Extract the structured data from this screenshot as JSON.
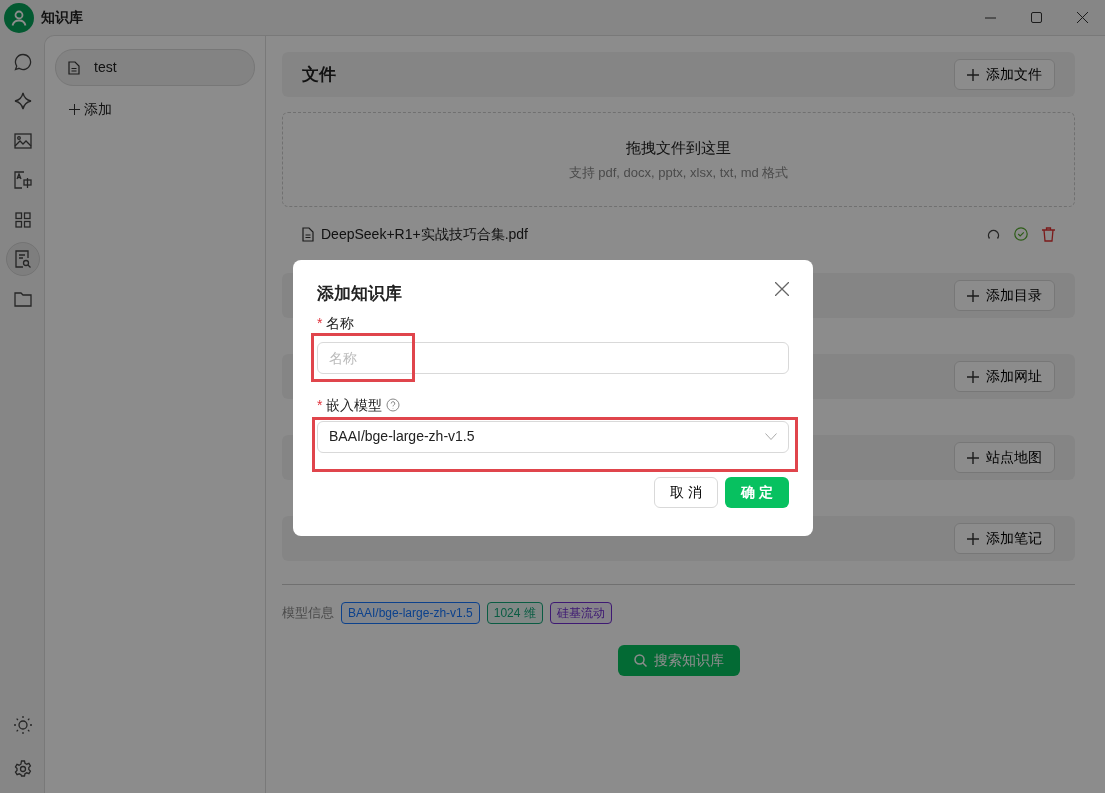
{
  "window": {
    "title": "知识库"
  },
  "rail": [
    {
      "kind": "chat",
      "selected": false
    },
    {
      "kind": "sparkle",
      "selected": false
    },
    {
      "kind": "image",
      "selected": false
    },
    {
      "kind": "translate",
      "selected": false
    },
    {
      "kind": "grid",
      "selected": false
    },
    {
      "kind": "knowledge",
      "selected": true
    },
    {
      "kind": "folder",
      "selected": false
    }
  ],
  "rail_bottom": [
    {
      "kind": "sun"
    },
    {
      "kind": "gear"
    }
  ],
  "knowledge_bases": [
    {
      "name": "test",
      "selected": true
    }
  ],
  "add_knowledge_base": "添加",
  "sections": [
    {
      "kind": "files",
      "title": "文件",
      "button": "添加文件"
    },
    {
      "kind": "plain",
      "button": "添加目录"
    },
    {
      "kind": "plain",
      "button": "添加网址"
    },
    {
      "kind": "plain",
      "button": "站点地图"
    },
    {
      "kind": "plain",
      "button": "添加笔记"
    }
  ],
  "dropzone": {
    "title": "拖拽文件到这里",
    "hint": "支持 pdf, docx, pptx, xlsx, txt, md 格式"
  },
  "files": [
    {
      "name": "DeepSeek+R1+实战技巧合集.pdf",
      "done": true
    }
  ],
  "model_info": {
    "label": "模型信息",
    "tags": [
      {
        "text": "BAAI/bge-large-zh-v1.5",
        "kind": "model"
      },
      {
        "text": "1024 维",
        "kind": "dimension"
      },
      {
        "text": "硅基流动",
        "kind": "provider"
      }
    ]
  },
  "search_button": "搜索知识库",
  "dialog": {
    "title": "添加知识库",
    "name_field": {
      "mark": "*",
      "label": "名称",
      "placeholder": "名称",
      "highlighted": true
    },
    "model_field": {
      "mark": "*",
      "label": "嵌入模型",
      "value": "BAAI/bge-large-zh-v1.5",
      "highlighted": true
    },
    "buttons": [
      {
        "kind": "cancel",
        "label": "取 消"
      },
      {
        "kind": "ok",
        "label": "确 定"
      }
    ]
  }
}
